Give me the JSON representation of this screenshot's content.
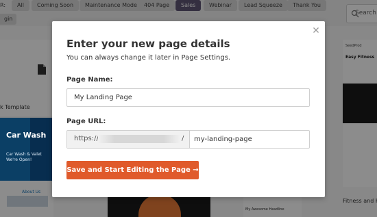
{
  "filter_bar": {
    "prefix": "R:",
    "categories": [
      "All",
      "Coming Soon",
      "Maintenance Mode",
      "404 Page",
      "Sales",
      "Webinar",
      "Lead Squeeze",
      "Thank You"
    ],
    "active_category": "Sales",
    "second_row_item": "gin",
    "search_placeholder": "Search"
  },
  "background": {
    "blank_card_label": "k Template",
    "car_wash_title": "Car Wash",
    "car_wash_subtitle": "Car Wash & Valet We're Open!",
    "about_title": "About Us",
    "light_card_title": "My Awesome Headline",
    "right_card_brand": "SeedProd",
    "right_card_title": "Easy Fitness",
    "right_card_label": "Fitness and He"
  },
  "modal": {
    "title": "Enter your new page details",
    "subtitle": "You can always change it later in Page Settings.",
    "page_name_label": "Page Name:",
    "page_name_value": "My Landing Page",
    "page_url_label": "Page URL:",
    "url_scheme": "https://",
    "url_slash": "/",
    "url_slug_value": "my-landing-page",
    "save_button_label": "Save and Start Editing the Page  →"
  },
  "colors": {
    "accent": "#e05a2b",
    "active_filter": "#5f5676",
    "overlay": "rgba(0,0,0,0.45)"
  }
}
